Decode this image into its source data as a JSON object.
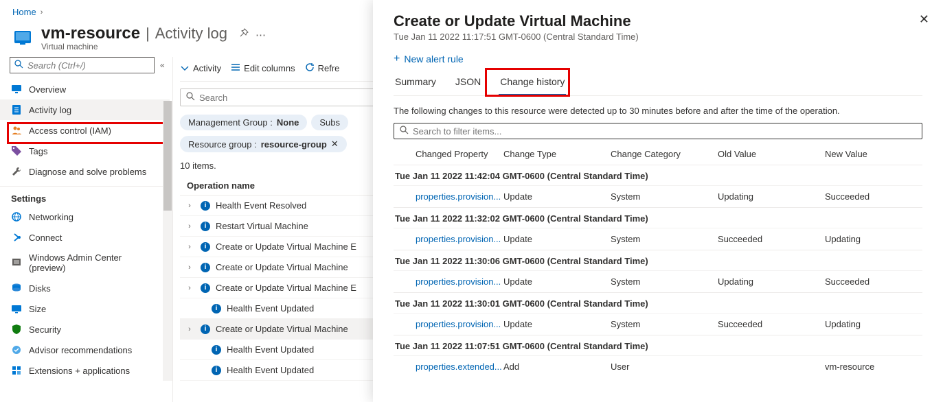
{
  "breadcrumb": {
    "home": "Home"
  },
  "header": {
    "title": "vm-resource",
    "section": "Activity log",
    "subtitle": "Virtual machine"
  },
  "sidebar": {
    "search_placeholder": "Search (Ctrl+/)",
    "items": [
      {
        "label": "Overview",
        "icon": "monitor"
      },
      {
        "label": "Activity log",
        "icon": "log",
        "active": true
      },
      {
        "label": "Access control (IAM)",
        "icon": "people"
      },
      {
        "label": "Tags",
        "icon": "tag"
      },
      {
        "label": "Diagnose and solve problems",
        "icon": "wrench"
      }
    ],
    "section_label": "Settings",
    "settings": [
      {
        "label": "Networking",
        "icon": "network"
      },
      {
        "label": "Connect",
        "icon": "connect"
      },
      {
        "label": "Windows Admin Center (preview)",
        "icon": "wac"
      },
      {
        "label": "Disks",
        "icon": "disks"
      },
      {
        "label": "Size",
        "icon": "size"
      },
      {
        "label": "Security",
        "icon": "shield"
      },
      {
        "label": "Advisor recommendations",
        "icon": "advisor"
      },
      {
        "label": "Extensions + applications",
        "icon": "ext"
      }
    ]
  },
  "toolbar": {
    "activity": "Activity",
    "edit_columns": "Edit columns",
    "refresh": "Refre"
  },
  "filters": {
    "search_placeholder": "Search",
    "mg_label": "Management Group : ",
    "mg_value": "None",
    "subs_label": "Subs",
    "rg_label": "Resource group : ",
    "rg_value": "resource-group"
  },
  "list": {
    "count": "10 items.",
    "header": "Operation name",
    "ops": [
      {
        "label": "Health Event Resolved",
        "expandable": true
      },
      {
        "label": "Restart Virtual Machine",
        "expandable": true
      },
      {
        "label": "Create or Update Virtual Machine E",
        "expandable": true
      },
      {
        "label": "Create or Update Virtual Machine",
        "expandable": true
      },
      {
        "label": "Create or Update Virtual Machine E",
        "expandable": true
      },
      {
        "label": "Health Event Updated",
        "expandable": false
      },
      {
        "label": "Create or Update Virtual Machine",
        "expandable": true,
        "selected": true
      },
      {
        "label": "Health Event Updated",
        "expandable": false
      },
      {
        "label": "Health Event Updated",
        "expandable": false
      }
    ]
  },
  "panel": {
    "title": "Create or Update Virtual Machine",
    "timestamp": "Tue Jan 11 2022 11:17:51 GMT-0600 (Central Standard Time)",
    "new_alert": "New alert rule",
    "tabs": {
      "summary": "Summary",
      "json": "JSON",
      "change_history": "Change history"
    },
    "desc": "The following changes to this resource were detected up to 30 minutes before and after the time of the operation.",
    "filter_placeholder": "Search to filter items...",
    "columns": {
      "prop": "Changed Property",
      "type": "Change Type",
      "cat": "Change Category",
      "old": "Old Value",
      "new": "New Value"
    },
    "groups": [
      {
        "ts": "Tue Jan 11 2022 11:42:04 GMT-0600 (Central Standard Time)",
        "rows": [
          {
            "prop": "properties.provision...",
            "type": "Update",
            "cat": "System",
            "old": "Updating",
            "new": "Succeeded"
          }
        ]
      },
      {
        "ts": "Tue Jan 11 2022 11:32:02 GMT-0600 (Central Standard Time)",
        "rows": [
          {
            "prop": "properties.provision...",
            "type": "Update",
            "cat": "System",
            "old": "Succeeded",
            "new": "Updating"
          }
        ]
      },
      {
        "ts": "Tue Jan 11 2022 11:30:06 GMT-0600 (Central Standard Time)",
        "rows": [
          {
            "prop": "properties.provision...",
            "type": "Update",
            "cat": "System",
            "old": "Updating",
            "new": "Succeeded"
          }
        ]
      },
      {
        "ts": "Tue Jan 11 2022 11:30:01 GMT-0600 (Central Standard Time)",
        "rows": [
          {
            "prop": "properties.provision...",
            "type": "Update",
            "cat": "System",
            "old": "Succeeded",
            "new": "Updating"
          }
        ]
      },
      {
        "ts": "Tue Jan 11 2022 11:07:51 GMT-0600 (Central Standard Time)",
        "rows": [
          {
            "prop": "properties.extended...",
            "type": "Add",
            "cat": "User",
            "old": "",
            "new": "vm-resource"
          }
        ]
      }
    ]
  }
}
